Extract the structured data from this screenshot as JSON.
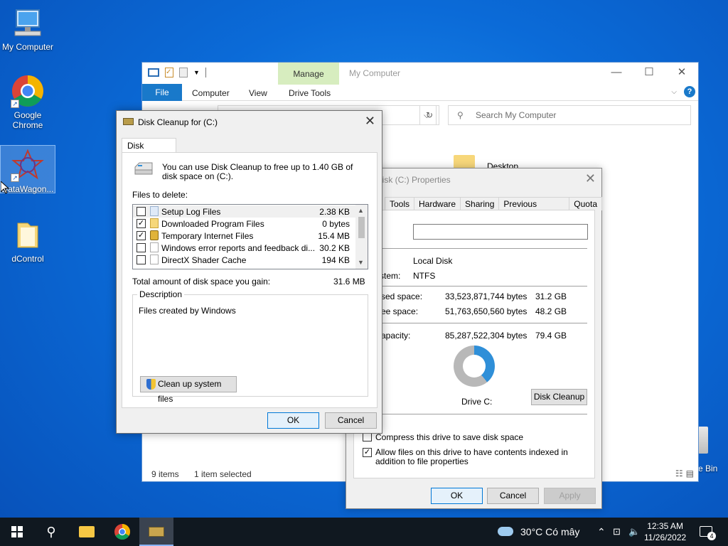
{
  "desktop": {
    "icons": [
      {
        "label": "My Computer"
      },
      {
        "label": "Google Chrome"
      },
      {
        "label": "DataWagon..."
      },
      {
        "label": "dControl"
      }
    ],
    "recycle_bin_partial": "e Bin"
  },
  "explorer": {
    "title": "My Computer",
    "manage_tab": "Manage",
    "tabs": [
      "File",
      "Computer",
      "View",
      "Drive Tools"
    ],
    "search_placeholder": "Search My Computer",
    "desktop_item": "Desktop",
    "status_items": "9 items",
    "status_selected": "1 item selected"
  },
  "properties": {
    "title": "l Disk (C:) Properties",
    "tabs": [
      "Tools",
      "Hardware",
      "Sharing",
      "Previous Versions",
      "Quota"
    ],
    "type_value": "Local Disk",
    "fs_label": "stem:",
    "fs_value": "NTFS",
    "used_label": "sed space:",
    "used_bytes": "33,523,871,744 bytes",
    "used_gb": "31.2 GB",
    "free_label": "ee space:",
    "free_bytes": "51,763,650,560 bytes",
    "free_gb": "48.2 GB",
    "capacity_label": "apacity:",
    "capacity_bytes": "85,287,522,304 bytes",
    "capacity_gb": "79.4 GB",
    "used_fraction": 0.393,
    "drive_label": "Drive C:",
    "disk_cleanup_button": "Disk Cleanup",
    "compress_label": "Compress this drive to save disk space",
    "compress_checked": false,
    "index_label": "Allow files on this drive to have contents indexed in addition to file properties",
    "index_checked": true,
    "ok": "OK",
    "cancel": "Cancel",
    "apply": "Apply",
    "used_color": "#2f8fd8",
    "free_color": "#b8b8b8"
  },
  "cleanup": {
    "title": "Disk Cleanup for  (C:)",
    "tab": "Disk Cleanup",
    "info": "You can use Disk Cleanup to free up to 1.40 GB of disk space on  (C:).",
    "files_label": "Files to delete:",
    "files": [
      {
        "name": "Setup Log Files",
        "size": "2.38 KB",
        "checked": false,
        "selected": true
      },
      {
        "name": "Downloaded Program Files",
        "size": "0 bytes",
        "checked": true,
        "selected": false
      },
      {
        "name": "Temporary Internet Files",
        "size": "15.4 MB",
        "checked": true,
        "selected": false
      },
      {
        "name": "Windows error reports and feedback di...",
        "size": "30.2 KB",
        "checked": false,
        "selected": false
      },
      {
        "name": "DirectX Shader Cache",
        "size": "194 KB",
        "checked": false,
        "selected": false
      }
    ],
    "total_label": "Total amount of disk space you gain:",
    "total_value": "31.6 MB",
    "description_label": "Description",
    "description_text": "Files created by Windows",
    "system_button": "Clean up system files",
    "ok": "OK",
    "cancel": "Cancel"
  },
  "taskbar": {
    "weather": "30°C  Có mây",
    "time": "12:35 AM",
    "date": "11/26/2022",
    "notifications": "4"
  }
}
